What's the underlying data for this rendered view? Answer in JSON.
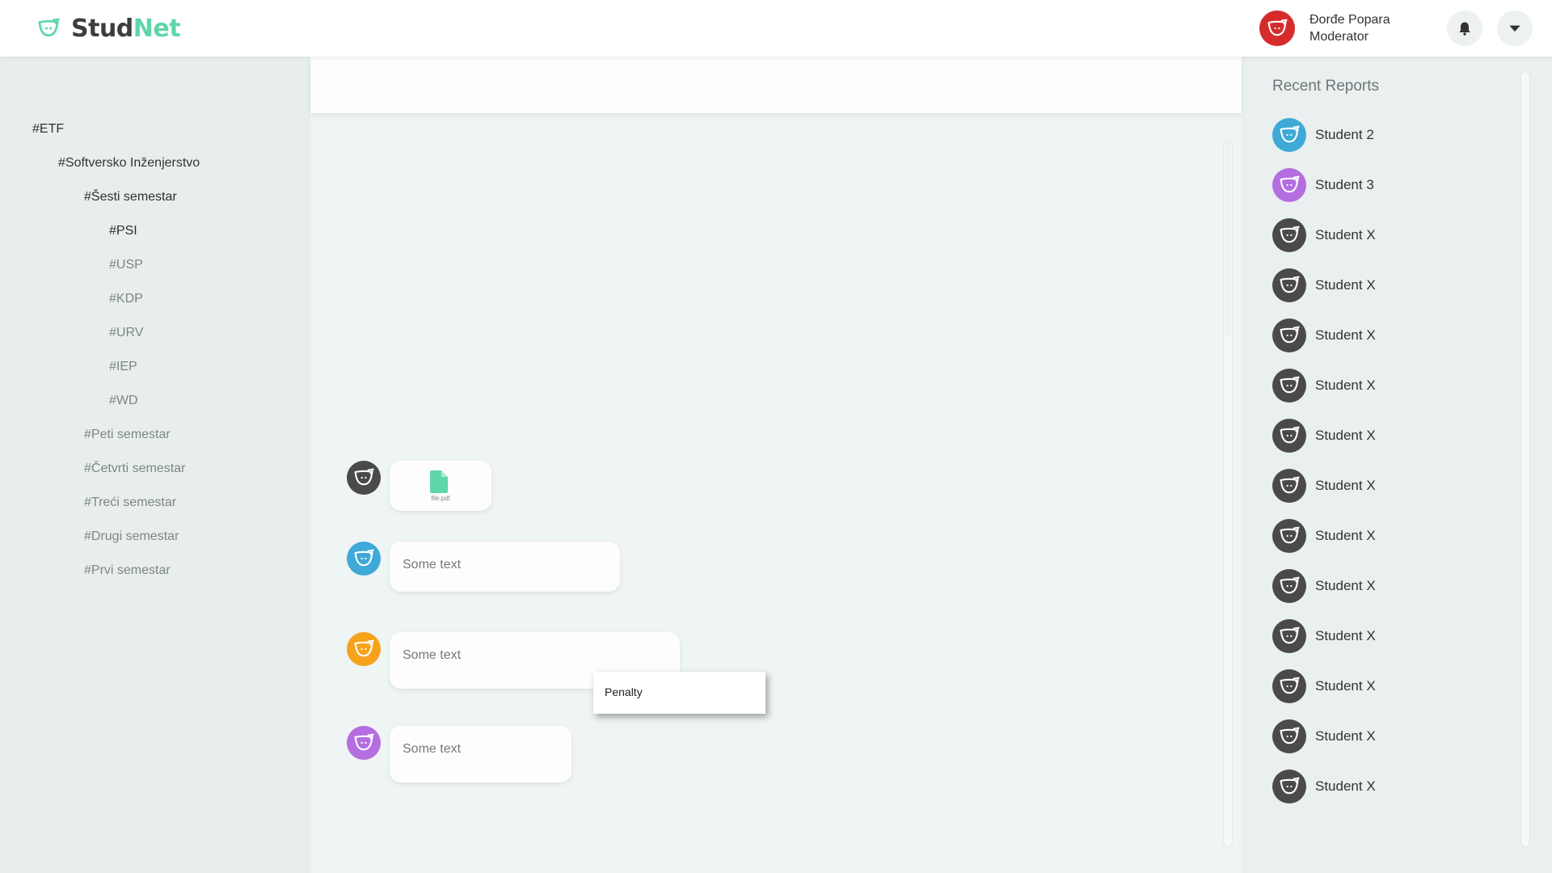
{
  "header": {
    "logo_text_part1": "Stud",
    "logo_text_part2": "Net",
    "user_name": "Đorđe Popara",
    "user_role": "Moderator",
    "colors": {
      "brand_green": "#5fd6a9",
      "user_avatar": "#d62b2b"
    }
  },
  "sidebar": {
    "items": [
      {
        "label": "#ETF"
      },
      {
        "label": "#Softversko Inženjerstvo"
      },
      {
        "label": "#Šesti semestar"
      },
      {
        "label": "#PSI"
      },
      {
        "label": "#USP"
      },
      {
        "label": "#KDP"
      },
      {
        "label": "#URV"
      },
      {
        "label": "#IEP"
      },
      {
        "label": "#WD"
      },
      {
        "label": "#Peti semestar"
      },
      {
        "label": "#Četvrti semestar"
      },
      {
        "label": "#Treći semestar"
      },
      {
        "label": "#Drugi semestar"
      },
      {
        "label": "#Prvi semestar"
      }
    ]
  },
  "chat": {
    "messages": [
      {
        "type": "file",
        "file_name": "file.pdf",
        "avatar_color": "#4a4a4a"
      },
      {
        "type": "text",
        "text": "Some text",
        "avatar_color": "#3fa9d8"
      },
      {
        "type": "text",
        "text": "Some text",
        "avatar_color": "#f7a21b"
      },
      {
        "type": "text",
        "text": "Some text",
        "avatar_color": "#b46ee0"
      }
    ],
    "context_menu": {
      "items": [
        "Penalty"
      ]
    }
  },
  "reports": {
    "title": "Recent Reports",
    "items": [
      {
        "name": "Student 2",
        "avatar_color": "#3fa9d8"
      },
      {
        "name": "Student 3",
        "avatar_color": "#b46ee0"
      },
      {
        "name": "Student X",
        "avatar_color": "#4a4a4a"
      },
      {
        "name": "Student X",
        "avatar_color": "#4a4a4a"
      },
      {
        "name": "Student X",
        "avatar_color": "#4a4a4a"
      },
      {
        "name": "Student X",
        "avatar_color": "#4a4a4a"
      },
      {
        "name": "Student X",
        "avatar_color": "#4a4a4a"
      },
      {
        "name": "Student X",
        "avatar_color": "#4a4a4a"
      },
      {
        "name": "Student X",
        "avatar_color": "#4a4a4a"
      },
      {
        "name": "Student X",
        "avatar_color": "#4a4a4a"
      },
      {
        "name": "Student X",
        "avatar_color": "#4a4a4a"
      },
      {
        "name": "Student X",
        "avatar_color": "#4a4a4a"
      },
      {
        "name": "Student X",
        "avatar_color": "#4a4a4a"
      },
      {
        "name": "Student X",
        "avatar_color": "#4a4a4a"
      }
    ]
  }
}
